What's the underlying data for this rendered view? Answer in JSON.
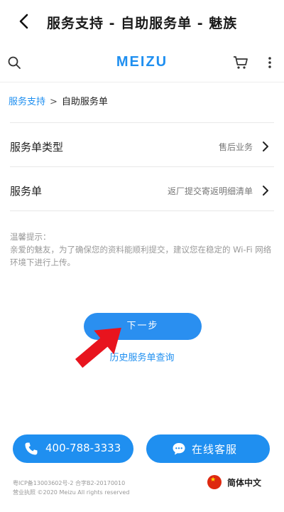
{
  "titlebar": {
    "title": "服务支持 - 自助服务单 - 魅族"
  },
  "site": {
    "logo": "MEIZU"
  },
  "breadcrumb": {
    "link": "服务支持",
    "separator": ">",
    "current": "自助服务单"
  },
  "form": {
    "rows": [
      {
        "label": "服务单类型",
        "value": "售后业务"
      },
      {
        "label": "服务单",
        "value": "返厂提交寄返明细清单"
      }
    ]
  },
  "tips": {
    "heading": "温馨提示：",
    "body": "亲爱的魅友，为了确保您的资料能顺利提交，建议您在稳定的 Wi-Fi 网络环境下进行上传。"
  },
  "actions": {
    "next_label": "下一步",
    "history_label": "历史服务单查询"
  },
  "footer": {
    "phone_label": "400-788-3333",
    "chat_label": "在线客服",
    "copyright_line1": "粤ICP备13003602号-2 合字B2-20170010",
    "copyright_line2": "营业执照 ©2020 Meizu All rights reserved",
    "language": "简体中文"
  },
  "colors": {
    "accent": "#1f8ff0",
    "annotation_arrow": "#e8141e"
  },
  "icons": [
    "back-arrow-icon",
    "search-icon",
    "cart-icon",
    "more-icon",
    "chevron-right-icon",
    "phone-icon",
    "chat-icon",
    "china-flag-icon"
  ]
}
